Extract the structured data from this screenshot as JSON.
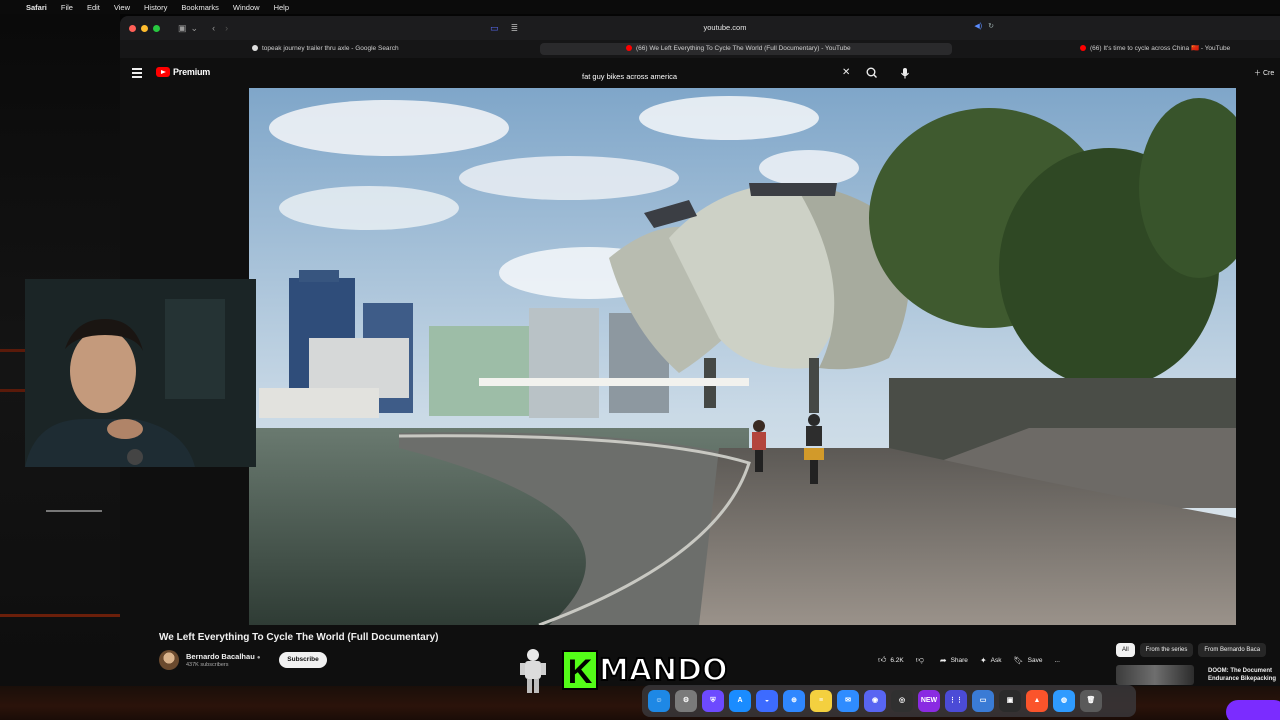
{
  "menubar": {
    "app": "Safari",
    "items": [
      "File",
      "Edit",
      "View",
      "History",
      "Bookmarks",
      "Window",
      "Help"
    ]
  },
  "browser": {
    "url": "youtube.com",
    "tabs": [
      {
        "label": "topeak journey trailer thru axle - Google Search",
        "active": false
      },
      {
        "label": "(66) We Left Everything To Cycle The World (Full Documentary) - YouTube",
        "active": true
      },
      {
        "label": "(66) It's time to cycle across China 🇨🇳 - YouTube",
        "active": false
      }
    ]
  },
  "youtube": {
    "logo_text": "Premium",
    "search_value": "fat guy bikes across america",
    "create_label": "Cre"
  },
  "video": {
    "title": "We Left Everything To Cycle The World (Full Documentary)",
    "channel": "Bernardo Bacalhau",
    "subscribers": "437K subscribers",
    "subscribe_label": "Subscribe",
    "likes": "6.2K",
    "share_label": "Share",
    "ask_label": "Ask",
    "save_label": "Save",
    "more_label": "..."
  },
  "sidebar": {
    "chips": [
      {
        "label": "All",
        "active": true
      },
      {
        "label": "From the series",
        "active": false
      },
      {
        "label": "From Bernardo Baca",
        "active": false
      }
    ],
    "recommended_title": "DOOM: The Document",
    "recommended_sub": "Endurance Bikepacking"
  },
  "overlay": {
    "brand_k": "K",
    "brand_word": "MANDO"
  },
  "dock": {
    "apps": [
      {
        "name": "finder-icon",
        "color": "#1e88e5",
        "glyph": "☺"
      },
      {
        "name": "settings-icon",
        "color": "#7a7a7a",
        "glyph": "⚙"
      },
      {
        "name": "proton-icon",
        "color": "#6d4aff",
        "glyph": "⛨"
      },
      {
        "name": "app-store-icon",
        "color": "#1a8cff",
        "glyph": "A"
      },
      {
        "name": "arc-icon",
        "color": "#3d6bff",
        "glyph": "◒"
      },
      {
        "name": "safari-icon",
        "color": "#2f87ff",
        "glyph": "⊕"
      },
      {
        "name": "notes-icon",
        "color": "#f4d03f",
        "glyph": "≡"
      },
      {
        "name": "mail-icon",
        "color": "#2f8cff",
        "glyph": "✉"
      },
      {
        "name": "discord-icon",
        "color": "#5865f2",
        "glyph": "◉"
      },
      {
        "name": "obs-icon",
        "color": "#303030",
        "glyph": "◎"
      },
      {
        "name": "new-app-icon",
        "color": "#8a2be2",
        "glyph": "NEW"
      },
      {
        "name": "launchpad-icon",
        "color": "#4b4bd6",
        "glyph": "⋮⋮"
      },
      {
        "name": "screen-icon",
        "color": "#3a7bd5",
        "glyph": "▭"
      },
      {
        "name": "chip-icon",
        "color": "#2b2b2b",
        "glyph": "▣"
      },
      {
        "name": "brave-icon",
        "color": "#fb542b",
        "glyph": "▲"
      },
      {
        "name": "chat-icon",
        "color": "#2f9bff",
        "glyph": "◍"
      },
      {
        "name": "trash-icon",
        "color": "#5a5a5a",
        "glyph": "🗑"
      }
    ]
  }
}
